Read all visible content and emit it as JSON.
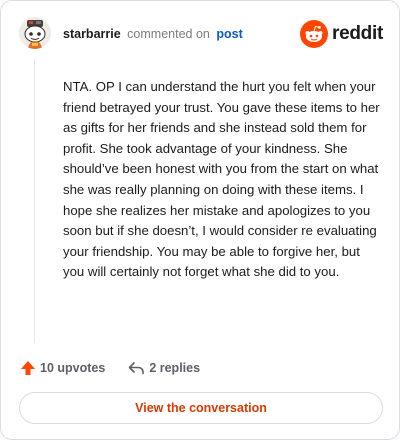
{
  "header": {
    "username": "starbarrie",
    "commented_on": "commented on",
    "post_link": "post",
    "brand_word": "reddit"
  },
  "comment": {
    "text": "NTA. OP I can understand the hurt you felt when your friend betrayed your trust. You gave these items to her as gifts for her friends and she instead sold them for profit. She took advantage of your kindness. She should’ve been honest with you from the start on what she was really planning on doing with these items. I hope she realizes her mistake and apologizes to you soon but if she doesn’t, I would consider re evaluating your friendship. You may be able to forgive her, but you will certainly not forget what she did to you."
  },
  "actions": {
    "upvotes": "10 upvotes",
    "replies": "2 replies"
  },
  "cta": {
    "label": "View the conversation"
  },
  "icons": {
    "upvote": "upvote-arrow-icon",
    "reply": "reply-arrow-icon",
    "brand": "reddit-snoo-icon",
    "avatar": "snoo-avatar-icon"
  },
  "colors": {
    "brand_orange": "#ff4500",
    "upvote_orange": "#ff4500",
    "link_blue": "#0a58c9",
    "cta_text": "#d93a00",
    "border": "#d9dde2"
  }
}
